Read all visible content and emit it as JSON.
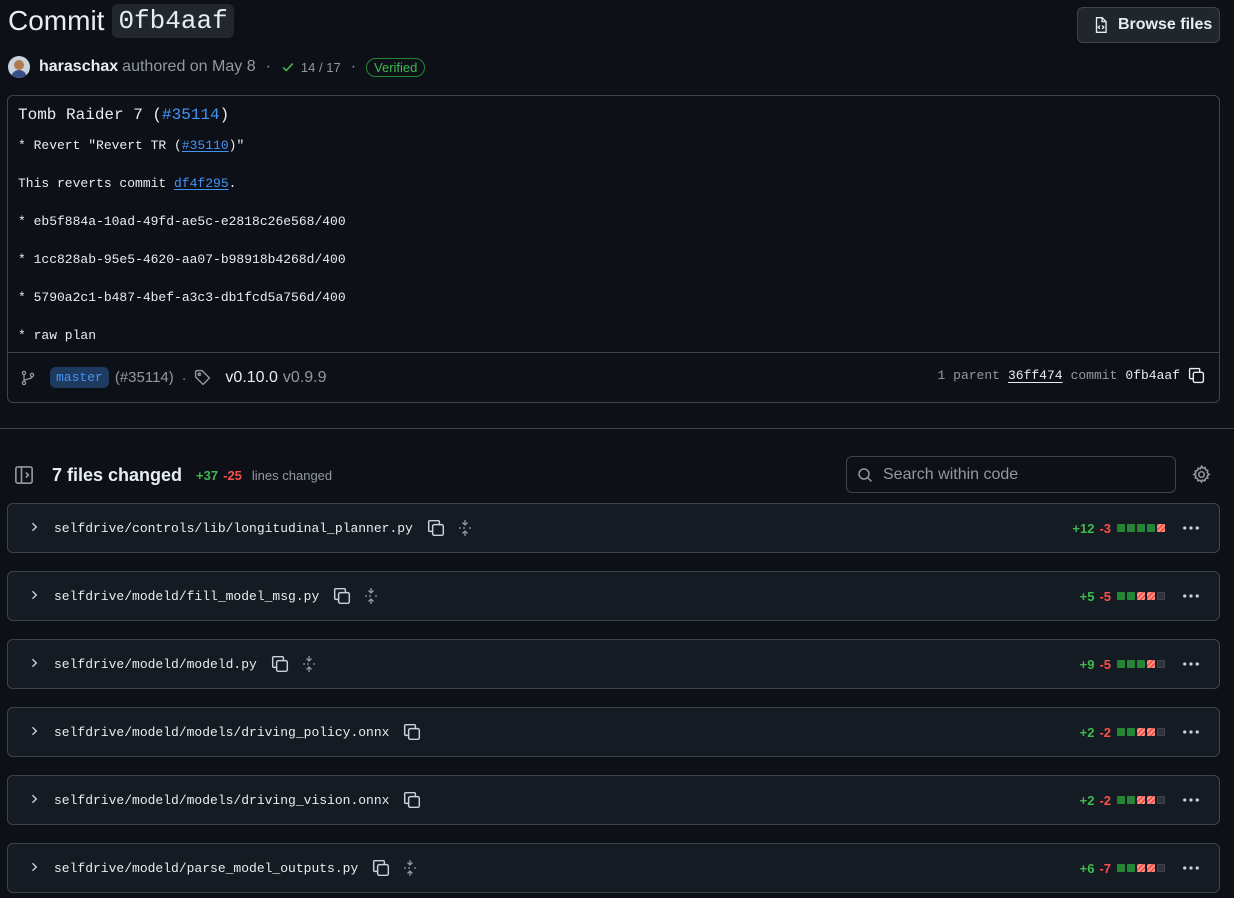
{
  "header": {
    "title_prefix": "Commit",
    "sha": "0fb4aaf",
    "browse_label": "Browse files"
  },
  "byline": {
    "author": "haraschax",
    "authored": "authored on May 8",
    "checks": "14 / 17",
    "verified": "Verified"
  },
  "message": {
    "title_text": "Tomb Raider 7 (",
    "title_link": "#35114",
    "title_end": ")",
    "revert_prefix": "* Revert \"Revert TR (",
    "revert_link": "#35110",
    "revert_suffix": ")\"",
    "reverts_prefix": "This reverts commit ",
    "reverts_link": "df4f295",
    "reverts_suffix": ".",
    "lines": [
      "* eb5f884a-10ad-49fd-ae5c-e2818c26e568/400",
      "* 1cc828ab-95e5-4620-aa07-b98918b4268d/400",
      "* 5790a2c1-b487-4bef-a3c3-db1fcd5a756d/400",
      "* raw plan"
    ]
  },
  "footer": {
    "branch": "master",
    "pr_ref": "(#35114)",
    "tag_primary": "v0.10.0",
    "tag_secondary": "v0.9.9",
    "parent_label": "1 parent",
    "parent_sha": "36ff474",
    "commit_label": "commit",
    "commit_sha": "0fb4aaf"
  },
  "files_changed": {
    "title": "7 files changed",
    "additions": "+37",
    "deletions": "-25",
    "lines_label": "lines changed",
    "search_placeholder": "Search within code"
  },
  "files": [
    {
      "path": "selfdrive/controls/lib/longitudinal_planner.py",
      "add": "+12",
      "del": "-3",
      "blocks": [
        "g",
        "g",
        "g",
        "g",
        "r"
      ],
      "expand": true
    },
    {
      "path": "selfdrive/modeld/fill_model_msg.py",
      "add": "+5",
      "del": "-5",
      "blocks": [
        "g",
        "g",
        "r",
        "r",
        "n"
      ],
      "expand": true
    },
    {
      "path": "selfdrive/modeld/modeld.py",
      "add": "+9",
      "del": "-5",
      "blocks": [
        "g",
        "g",
        "g",
        "r",
        "n"
      ],
      "expand": true
    },
    {
      "path": "selfdrive/modeld/models/driving_policy.onnx",
      "add": "+2",
      "del": "-2",
      "blocks": [
        "g",
        "g",
        "r",
        "r",
        "n"
      ],
      "expand": false
    },
    {
      "path": "selfdrive/modeld/models/driving_vision.onnx",
      "add": "+2",
      "del": "-2",
      "blocks": [
        "g",
        "g",
        "r",
        "r",
        "n"
      ],
      "expand": false
    },
    {
      "path": "selfdrive/modeld/parse_model_outputs.py",
      "add": "+6",
      "del": "-7",
      "blocks": [
        "g",
        "g",
        "r",
        "r",
        "n"
      ],
      "expand": true
    }
  ],
  "colors": {
    "background": "#0d1117",
    "border": "#3d444d",
    "addition": "#3fb950",
    "deletion": "#f85149",
    "link": "#4493f8"
  }
}
